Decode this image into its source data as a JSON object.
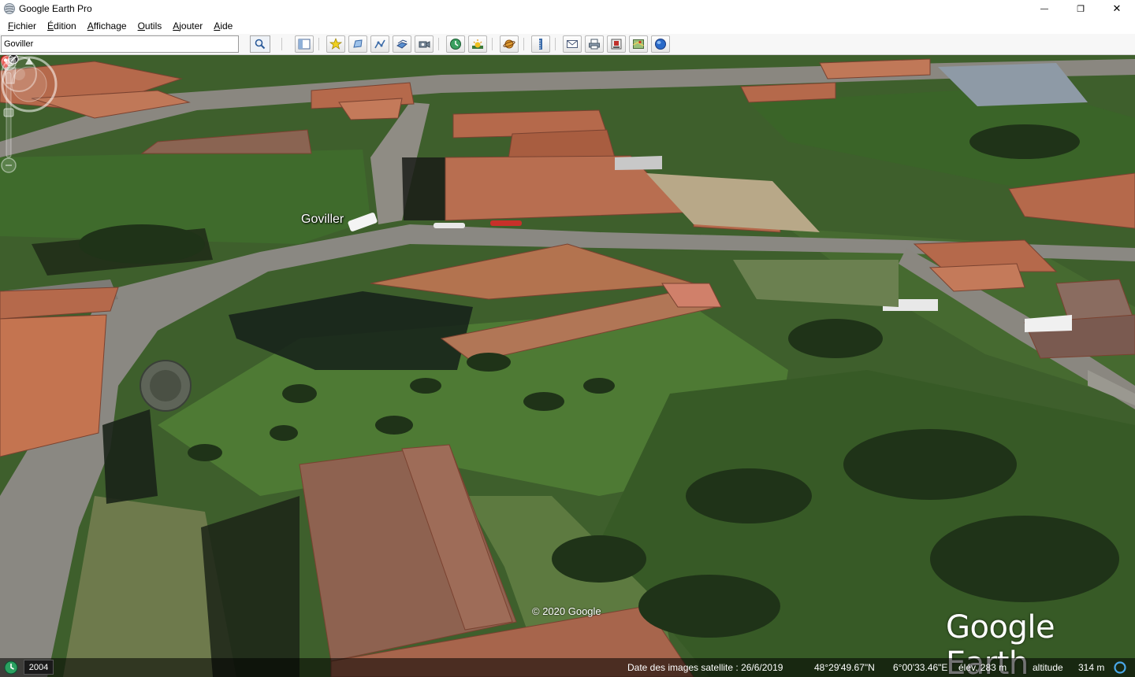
{
  "window": {
    "title": "Google Earth Pro",
    "minimize_glyph": "—",
    "maximize_glyph": "❐",
    "close_glyph": "✕"
  },
  "menu": [
    {
      "label": "Fichier",
      "accel": "F",
      "rest": "ichier"
    },
    {
      "label": "Édition",
      "accel": "É",
      "rest": "dition"
    },
    {
      "label": "Affichage",
      "accel": "A",
      "rest": "ffichage"
    },
    {
      "label": "Outils",
      "accel": "O",
      "rest": "utils"
    },
    {
      "label": "Ajouter",
      "accel": "A",
      "rest": "jouter"
    },
    {
      "label": "Aide",
      "accel": "A",
      "rest": "ide"
    }
  ],
  "search": {
    "value": "Goviller"
  },
  "toolbar_icons": [
    "sidebar-toggle-icon",
    "add-placemark-icon",
    "add-polygon-icon",
    "add-path-icon",
    "add-image-overlay-icon",
    "record-tour-icon",
    "historical-imagery-icon",
    "sunlight-icon",
    "planets-icon",
    "ruler-icon",
    "email-icon",
    "print-icon",
    "save-image-icon",
    "view-in-maps-icon",
    "sign-in-icon"
  ],
  "map": {
    "placemark_label": "Goviller",
    "copyright": "© 2020 Google",
    "brand": "Google Earth"
  },
  "status": {
    "year": "2004",
    "imagery_date": "Date des images satellite : 26/6/2019",
    "latitude": "48°29'49.67\"N",
    "longitude": "6°00'33.46\"E",
    "elevation": "élév.  283 m",
    "altitude_label": "altitude",
    "altitude_value": "314 m"
  },
  "colors": {
    "roof": "#b86a4c",
    "grass": "#3f6b2c",
    "road": "#7f7d78"
  }
}
